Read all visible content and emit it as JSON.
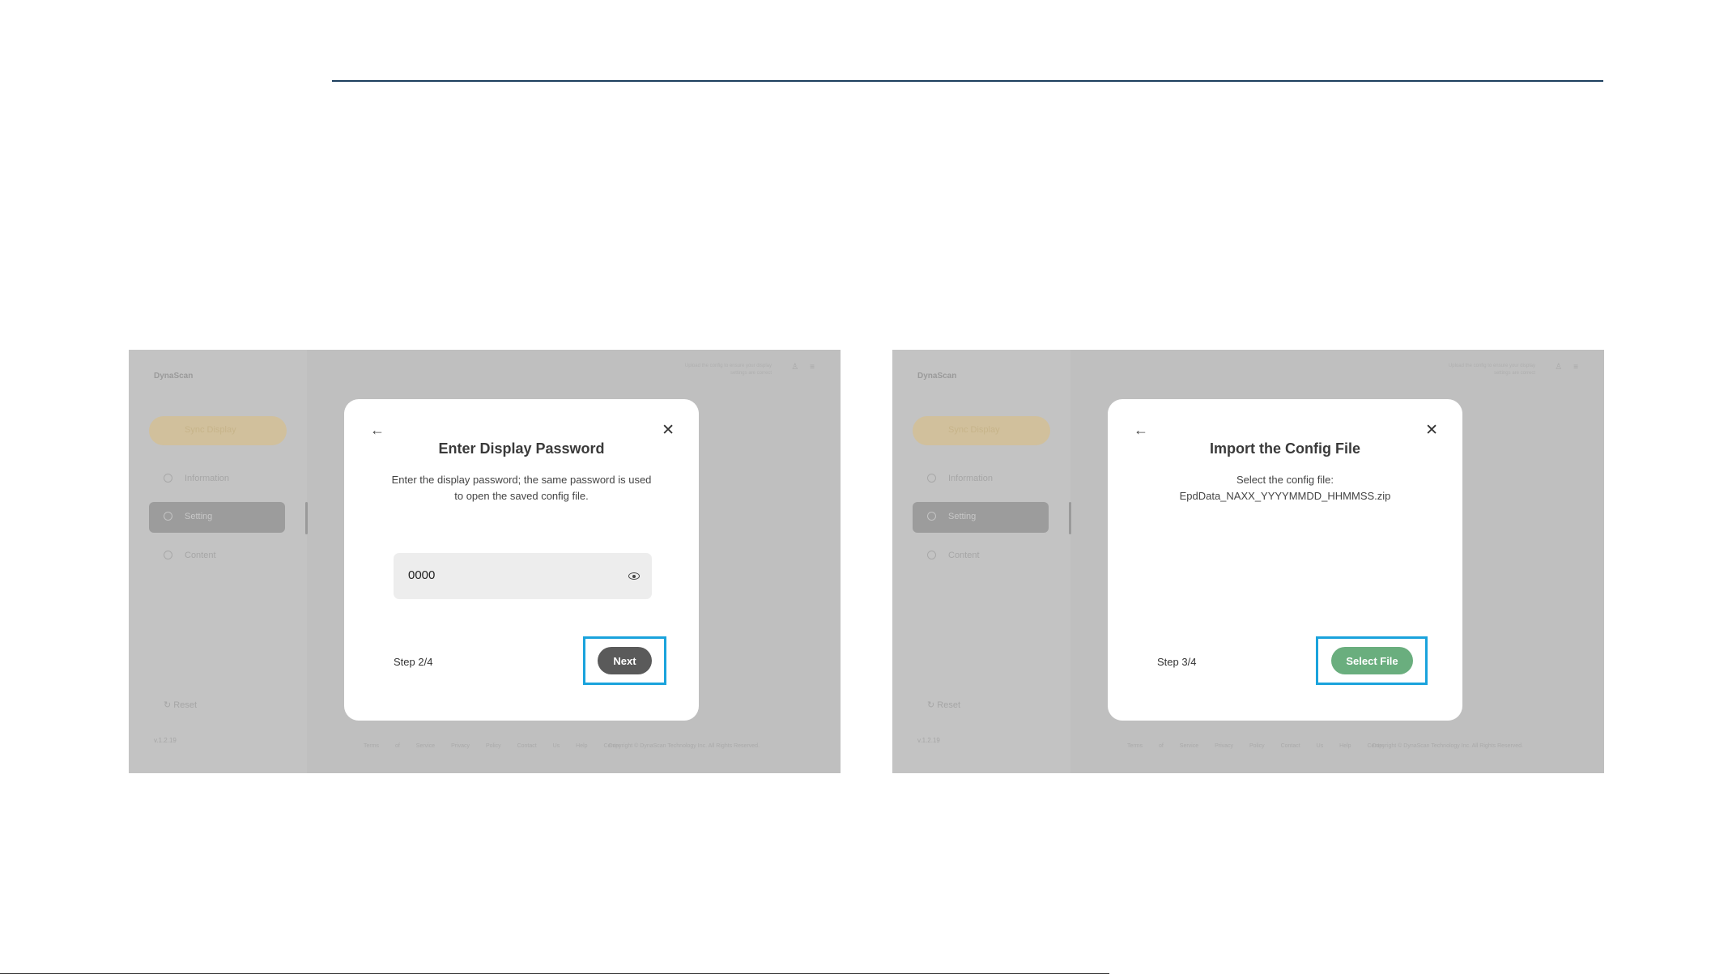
{
  "app": {
    "brand": "DynaScan",
    "version": "v.1.2.19"
  },
  "left": {
    "sidebar": {
      "button": "Sync Display",
      "items": [
        {
          "label": "Information",
          "active": false
        },
        {
          "label": "Setting",
          "active": true
        },
        {
          "label": "Content",
          "active": false
        }
      ],
      "reset": "Reset"
    },
    "topbar": {
      "text": "Upload the config to ensure your display settings are correct",
      "icons": [
        "user-icon",
        "menu-icon"
      ]
    },
    "footer": {
      "links": "Terms of Service  Privacy Policy  Contact Us  Help Center",
      "copyright": "Copyright © DynaScan Technology Inc. All Rights Reserved."
    },
    "modal": {
      "title": "Enter Display Password",
      "description": "Enter the display password; the same password is used to open the saved config file.",
      "password_value": "0000",
      "step": "Step 2/4",
      "button": "Next"
    }
  },
  "right": {
    "sidebar": {
      "button": "Sync Display",
      "items": [
        {
          "label": "Information",
          "active": false
        },
        {
          "label": "Setting",
          "active": true
        },
        {
          "label": "Content",
          "active": false
        }
      ],
      "reset": "Reset"
    },
    "topbar": {
      "text": "Upload the config to ensure your display settings are correct",
      "icons": [
        "user-icon",
        "menu-icon"
      ]
    },
    "footer": {
      "links": "Terms of Service  Privacy Policy  Contact Us  Help Center",
      "copyright": "Copyright © DynaScan Technology Inc. All Rights Reserved."
    },
    "modal": {
      "title": "Import the Config File",
      "description": "Select the config file: EpdData_NAXX_YYYYMMDD_HHMMSS.zip",
      "step": "Step 3/4",
      "button": "Select File"
    }
  },
  "colors": {
    "highlight": "#1aa3dc",
    "next_button": "#5a5a5a",
    "select_button": "#6aae7e",
    "rule": "#1d3f5e"
  }
}
